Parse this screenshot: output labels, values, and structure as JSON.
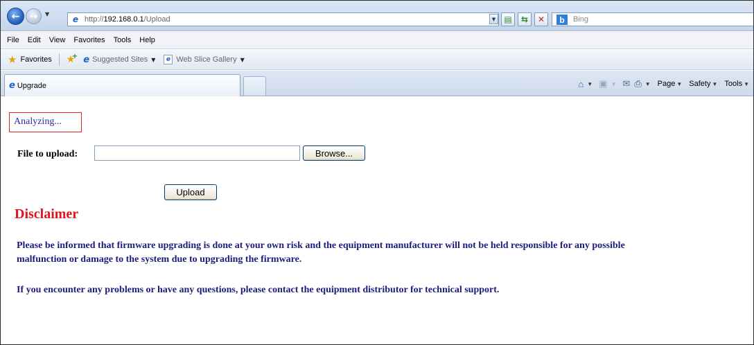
{
  "browser": {
    "url_prefix": "http://",
    "url_host": "192.168.0.1",
    "url_path": "/Upload",
    "search_placeholder": "Bing",
    "menu": [
      "File",
      "Edit",
      "View",
      "Favorites",
      "Tools",
      "Help"
    ],
    "favorites_label": "Favorites",
    "fav_links": [
      "Suggested Sites",
      "Web Slice Gallery"
    ],
    "tab_title": "Upgrade",
    "command_bar": {
      "page": "Page",
      "safety": "Safety",
      "tools": "Tools"
    },
    "icons": {
      "back": "back-arrow-icon",
      "forward": "forward-arrow-icon",
      "compat": "compatibility-view-icon",
      "refresh": "refresh-icon",
      "stop": "stop-icon",
      "home": "home-icon",
      "feeds": "feeds-icon",
      "mail": "mail-icon",
      "print": "print-icon"
    }
  },
  "page": {
    "status": "Analyzing...",
    "file_label": "File to upload:",
    "file_value": "",
    "browse_label": "Browse...",
    "upload_label": "Upload",
    "disclaimer_title": "Disclaimer",
    "disclaimer_line1": "Please be informed that firmware upgrading is done at your own risk and the equipment manufacturer will not be held responsible for any possible",
    "disclaimer_line2": "malfunction or damage to the system due to upgrading the firmware.",
    "support_text": "If you encounter any problems or have any questions, please contact the equipment distributor for technical support."
  },
  "colors": {
    "status_border": "#e3232a",
    "status_text": "#2a2aa8",
    "disclaimer_title": "#e1141c",
    "body_text": "#1c1c7a"
  }
}
